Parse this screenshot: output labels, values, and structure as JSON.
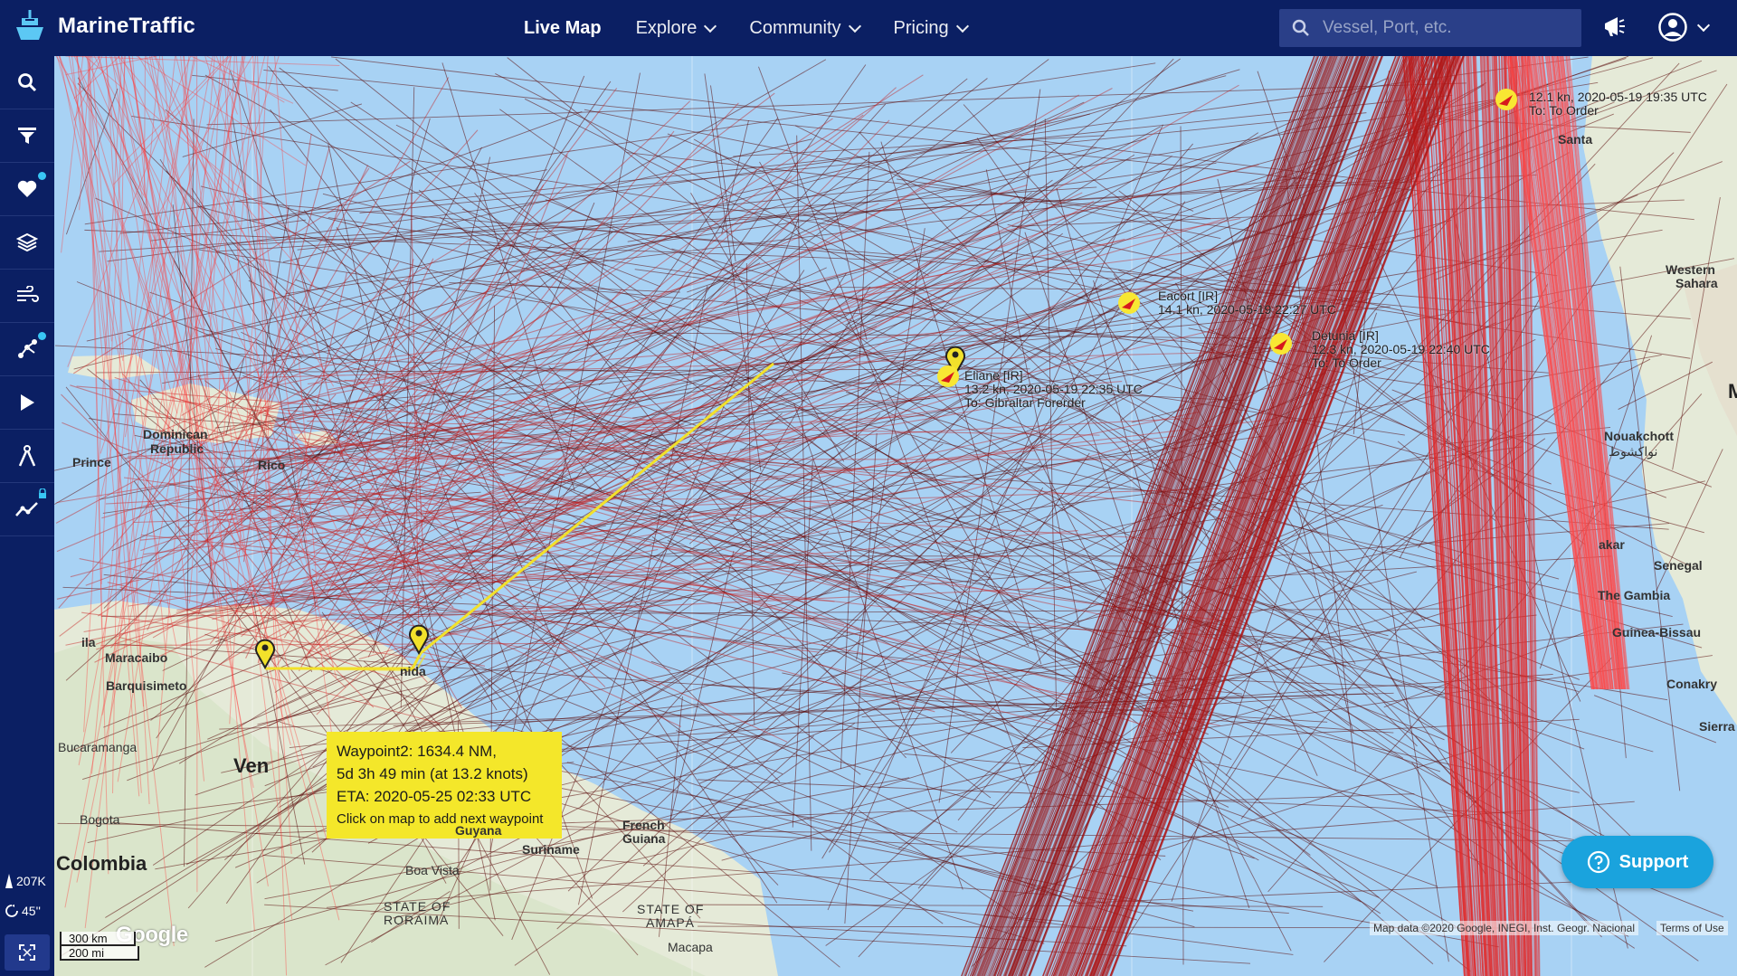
{
  "app": {
    "brand": "MarineTraffic"
  },
  "nav": [
    {
      "label": "Live Map",
      "active": true,
      "dropdown": false
    },
    {
      "label": "Explore",
      "active": false,
      "dropdown": true
    },
    {
      "label": "Community",
      "active": false,
      "dropdown": true
    },
    {
      "label": "Pricing",
      "active": false,
      "dropdown": true
    }
  ],
  "search": {
    "placeholder": "Vessel, Port, etc."
  },
  "sidebar": {
    "items": [
      {
        "icon": "search-icon"
      },
      {
        "icon": "filter-icon"
      },
      {
        "icon": "heart-icon",
        "badge": true
      },
      {
        "icon": "layers-icon"
      },
      {
        "icon": "wind-icon"
      },
      {
        "icon": "route-icon",
        "badge": true
      },
      {
        "icon": "play-icon"
      },
      {
        "icon": "measure-icon"
      },
      {
        "icon": "analytics-icon",
        "locked": true
      }
    ],
    "vessel_count": "207K",
    "refresh": "45''"
  },
  "map": {
    "route_tooltip": {
      "line1": "Waypoint2: 1634.4 NM,",
      "line2": "5d 3h 49 min (at 13.2 knots)",
      "line3": "ETA: 2020-05-25 02:33 UTC",
      "hint": "Click on map to add next waypoint"
    },
    "vessels": [
      {
        "name": "Eliane [IR]",
        "speed_time": "13.2 kn, 2020-05-19 22:35 UTC",
        "dest": "To: Gibraltar Forerder"
      },
      {
        "name": "Eacort [IR]",
        "speed_time": "14.1 kn, 2020-05-19 22:27 UTC",
        "dest": ""
      },
      {
        "name": "Detunia [IR]",
        "speed_time": "12.3 kn, 2020-05-19 22:40 UTC",
        "dest": "To: To Order"
      },
      {
        "name": "",
        "speed_time": "12.1 kn, 2020-05-19 19:35 UTC",
        "dest": "To: To Order"
      }
    ],
    "places": {
      "dominican": "Dominican",
      "republic": "Republic",
      "prince": "Prince",
      "rico": "Rico",
      "maracaibo": "Maracaibo",
      "barquisimeto": "Barquisimeto",
      "bucaramanga": "Bucaramanga",
      "ven": "Ven",
      "bogota": "Bogota",
      "colombia": "Colombia",
      "guyana": "Guyana",
      "suriname": "Suriname",
      "french": "French",
      "guiana": "Guiana",
      "boa_vista": "Boa Vista",
      "roraima1": "STATE OF",
      "roraima2": "RORAIMA",
      "amapa1": "STATE OF",
      "amapa2": "AMAPÁ",
      "macapa": "Macapa",
      "western": "Western",
      "sahara": "Sahara",
      "nouakchott": "Nouakchott",
      "nouakchott_ar": "نواكشوط",
      "senegal": "Senegal",
      "gambia": "The Gambia",
      "guinea_bissau": "Guinea-Bissau",
      "conakry": "Conakry",
      "sierra": "Sierra",
      "dakar": "akar",
      "santa": "Santa",
      "ila": "ila",
      "nida": "nida",
      "m": "M"
    },
    "scale": {
      "km": "300 km",
      "mi": "200 mi"
    },
    "attribution": "Map data ©2020 Google, INEGI, Inst. Geogr. Nacional",
    "terms": "Terms of Use",
    "google": "Google"
  },
  "support": {
    "label": "Support"
  },
  "colors": {
    "nav_bg": "#0b1f63",
    "ocean": "#a8d2f4",
    "tracks_dense": "#e32b2b",
    "tracks_sparse": "#5a0a0a",
    "route": "#f2e12b",
    "accent": "#38c6f4"
  }
}
